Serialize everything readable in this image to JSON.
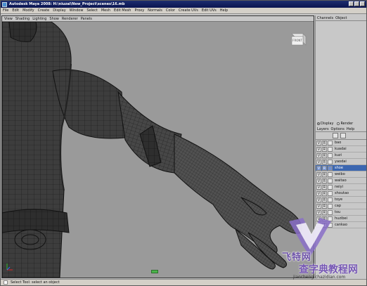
{
  "window": {
    "title": "Autodesk Maya 2008: H:\\niuzai\\New_Project\\scenes\\16.mb"
  },
  "main_menu": [
    "File",
    "Edit",
    "Modify",
    "Create",
    "Display",
    "Window",
    "Select",
    "Mesh",
    "Edit Mesh",
    "Proxy",
    "Normals",
    "Color",
    "Create UVs",
    "Edit UVs",
    "Help"
  ],
  "viewport": {
    "menu": [
      "View",
      "Shading",
      "Lighting",
      "Show",
      "Renderer",
      "Panels"
    ],
    "viewcube_label": "FRONT"
  },
  "channel_box": {
    "menu": [
      "Channels",
      "Object"
    ]
  },
  "layer_editor": {
    "mode": {
      "display_label": "Display",
      "render_label": "Render",
      "selected": "Display"
    },
    "menu": [
      "Layers",
      "Options",
      "Help"
    ],
    "layers": [
      {
        "v": "V",
        "r": "R",
        "name": "bao",
        "selected": false
      },
      {
        "v": "V",
        "r": "R",
        "name": "kuadai",
        "selected": false
      },
      {
        "v": "V",
        "r": "R",
        "name": "kuzi",
        "selected": false
      },
      {
        "v": "V",
        "r": "R",
        "name": "yaodai",
        "selected": false
      },
      {
        "v": "V",
        "r": "R",
        "name": "shoe",
        "selected": true
      },
      {
        "v": "V",
        "r": "R",
        "name": "weibo",
        "selected": false
      },
      {
        "v": "V",
        "r": "R",
        "name": "waitao",
        "selected": false
      },
      {
        "v": "V",
        "r": "R",
        "name": "neiyi",
        "selected": false
      },
      {
        "v": "V",
        "r": "R",
        "name": "shoutao",
        "selected": false
      },
      {
        "v": "V",
        "r": "R",
        "name": "toye",
        "selected": false
      },
      {
        "v": "V",
        "r": "R",
        "name": "cap",
        "selected": false
      },
      {
        "v": "V",
        "r": "R",
        "name": "tou",
        "selected": false
      },
      {
        "v": "V",
        "r": "R",
        "name": "huzibei",
        "selected": false
      },
      {
        "v": "",
        "r": "T",
        "name": "cankao",
        "selected": false
      }
    ]
  },
  "help_line": {
    "text": "Select Tool: select an object"
  },
  "watermark": {
    "text1": "飞特网",
    "text2": "查字典教程网",
    "url": "jiaocheng.chazidian.com"
  },
  "colors": {
    "title_bar": "#0a1450",
    "selected_layer": "#3b66b0",
    "viewport_bg": "#9a9a9a",
    "mesh": "#3c3c3c"
  },
  "icons": [
    "maya-app-icon",
    "viewcube-icon",
    "axis-icon",
    "new-layer-icon"
  ]
}
